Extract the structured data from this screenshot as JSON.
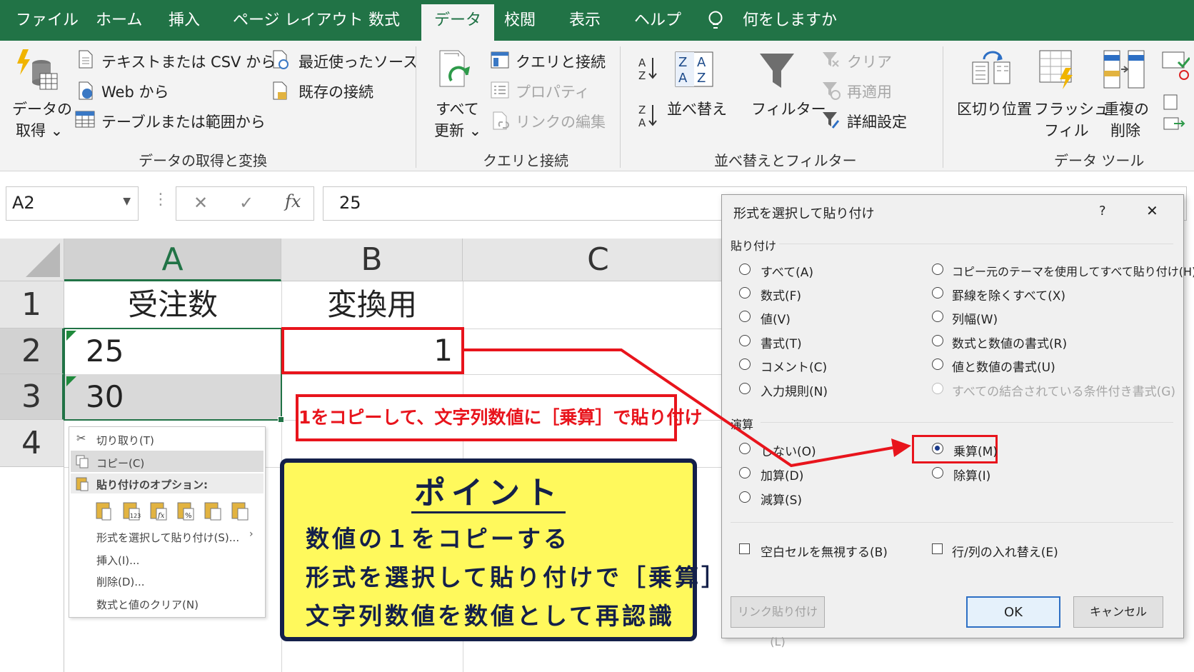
{
  "tabs": [
    {
      "label": "ファイル"
    },
    {
      "label": "ホーム"
    },
    {
      "label": "挿入"
    },
    {
      "label": "ページ レイアウト"
    },
    {
      "label": "数式"
    },
    {
      "label": "データ"
    },
    {
      "label": "校閲"
    },
    {
      "label": "表示"
    },
    {
      "label": "ヘルプ"
    }
  ],
  "tell_me": "何をしますか",
  "ribbon": {
    "get_data_1": "データの",
    "get_data_2": "取得 ⌄",
    "from_text_csv": "テキストまたは CSV から",
    "from_web": "Web から",
    "from_table": "テーブルまたは範囲から",
    "recent_sources": "最近使ったソース",
    "existing_connections": "既存の接続",
    "group_get_transform": "データの取得と変換",
    "refresh_all_1": "すべて",
    "refresh_all_2": "更新 ⌄",
    "queries_connections": "クエリと接続",
    "properties": "プロパティ",
    "edit_links": "リンクの編集",
    "group_queries": "クエリと接続",
    "sort": "並べ替え",
    "filter": "フィルター",
    "clear": "クリア",
    "reapply": "再適用",
    "advanced": "詳細設定",
    "group_sort_filter": "並べ替えとフィルター",
    "text_to_columns": "区切り位置",
    "flash_fill_1": "フラッシュ",
    "flash_fill_2": "フィル",
    "remove_dup_1": "重複の",
    "remove_dup_2": "削除",
    "group_data_tools": "データ ツール"
  },
  "formula_bar": {
    "name_box": "A2",
    "cancel": "✕",
    "enter": "✓",
    "fx": "fx",
    "value": "25"
  },
  "sheet": {
    "columns": [
      "A",
      "B",
      "C"
    ],
    "rows": [
      "1",
      "2",
      "3",
      "4"
    ],
    "a1": "受注数",
    "b1": "変換用",
    "a2": "25",
    "b2": "1",
    "a3": "30"
  },
  "context_menu": {
    "cut": "切り取り(T)",
    "copy": "コピー(C)",
    "paste_options": "貼り付けのオプション:",
    "paste_special": "形式を選択して貼り付け(S)...",
    "insert": "挿入(I)...",
    "delete": "削除(D)...",
    "clear": "数式と値のクリア(N)"
  },
  "callout": "1をコピーして、文字列数値に［乗算］で貼り付け",
  "point": {
    "title": "ポイント",
    "line1": "数値の１をコピーする",
    "line2": "形式を選択して貼り付けで［乗算］",
    "line3": "文字列数値を数値として再認識"
  },
  "dialog": {
    "title": "形式を選択して貼り付け",
    "help": "?",
    "close": "✕",
    "paste_section": "貼り付け",
    "paste_left": [
      "すべて(A)",
      "数式(F)",
      "値(V)",
      "書式(T)",
      "コメント(C)",
      "入力規則(N)"
    ],
    "paste_right": [
      "コピー元のテーマを使用してすべて貼り付け(H)",
      "罫線を除くすべて(X)",
      "列幅(W)",
      "数式と数値の書式(R)",
      "値と数値の書式(U)",
      "すべての結合されている条件付き書式(G)"
    ],
    "op_section": "演算",
    "op_left": [
      "しない(O)",
      "加算(D)",
      "減算(S)"
    ],
    "op_right": [
      "乗算(M)",
      "除算(I)"
    ],
    "skip_blanks": "空白セルを無視する(B)",
    "transpose": "行/列の入れ替え(E)",
    "paste_link": "リンク貼り付け(L)",
    "ok": "OK",
    "cancel": "キャンセル"
  },
  "colors": {
    "excel_green": "#217346",
    "red": "#e8141c",
    "yellow": "#fff95c",
    "navy": "#14204a"
  }
}
